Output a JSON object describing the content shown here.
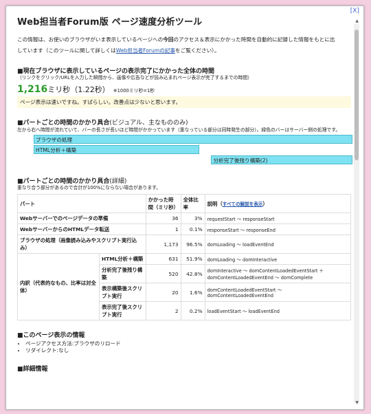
{
  "dialog": {
    "close": "[X]"
  },
  "title": "Web担当者Forum版 ページ速度分析ツール",
  "intro": {
    "line1_a": "この情報は、お使いのブラウザがいま表示しているページへの",
    "line1_b": "今回",
    "line1_c": "のアクセス＆表示にかかった時間を自動的に記録した情報をもとに出",
    "line2_a": "しています（このツールに関して詳しくは",
    "line2_link": "Web担当者Forumの記事",
    "line2_b": "をご覧ください）。"
  },
  "overall": {
    "title": "■現在ブラウザに表示しているページの表示完了にかかった全体の時間",
    "note": "（リンクをクリック/URLを入力した瞬間から、画像や広告などが読み込まれページ表示が完了するまでの時間）",
    "ms_value": "1,216",
    "ms_unit": "ミリ秒（1.22秒）",
    "ms_note": "※1000ミリ秒=1秒",
    "message": "ページ表示は速いですね。すばらしい。改善点は少ないと思います。"
  },
  "visual": {
    "title": "■パートごとの時間のかかり具合",
    "title_sub": "(ビジュアル、主なもののみ)",
    "note": "左から右へ時間が流れていて、バーの長さが長いほど時間がかかっています（重なっている部分は同時発生の部分）。緑色のバーはサーバー側の処理です。",
    "bars": [
      {
        "label": "ブラウザの処理",
        "start": 0.0,
        "end": 1.0
      },
      {
        "label": "HTML分析＋構築",
        "start": 0.0,
        "end": 0.519
      },
      {
        "label": "分析完了後残り構築(2)",
        "start": 0.557,
        "end": 1.0
      }
    ]
  },
  "detail": {
    "title": "■パートごとの時間のかかり具合",
    "title_sub": "(詳細)",
    "note": "重なり合う部分があるので合計が100%にならない場合があります。",
    "headers": {
      "part": "パート",
      "time": "かかった時間（ミリ秒）",
      "ratio": "全体比率",
      "desc_prefix": "説明（",
      "desc_link": "すべての解説を表示",
      "desc_suffix": "）"
    },
    "rows": [
      {
        "part": "Webサーバーでのページデータの準備",
        "time": "36",
        "ratio": "3%",
        "desc": "requestStart ～ responseStart"
      },
      {
        "part": "WebサーバーからのHTMLデータ転送",
        "time": "1",
        "ratio": "0.1%",
        "desc": "responseStart ～ responseEnd"
      },
      {
        "part": "ブラウザの処理（画像読み込みやスクリプト実行込み）",
        "time": "1,173",
        "ratio": "96.5%",
        "desc": "domLoading ～ loadEventEnd"
      }
    ],
    "group_label": "内訳（代表的なもの、比率は対全体）",
    "subrows": [
      {
        "part": "HTML分析＋構築",
        "time": "631",
        "ratio": "51.9%",
        "desc": "domLoading ～ domInteractive"
      },
      {
        "part": "分析完了後残り構築",
        "time": "520",
        "ratio": "42.8%",
        "desc": "domInteractive ～ domContentLoadedEventStart ＋ domContentLoadedEventEnd ～ domComplete"
      },
      {
        "part": "表示構築後スクリプト実行",
        "time": "20",
        "ratio": "1.6%",
        "desc": "domContentLoadedEventStart ～ domContentLoadedEventEnd"
      },
      {
        "part": "表示完了後スクリプト実行",
        "time": "2",
        "ratio": "0.2%",
        "desc": "loadEventStart ～ loadEventEnd"
      }
    ]
  },
  "pageinfo": {
    "title": "■このページ表示の情報",
    "items": [
      "ページアクセス方法:ブラウザのリロード",
      "リダイレクト:なし"
    ]
  },
  "details": {
    "title": "■詳細情報"
  }
}
